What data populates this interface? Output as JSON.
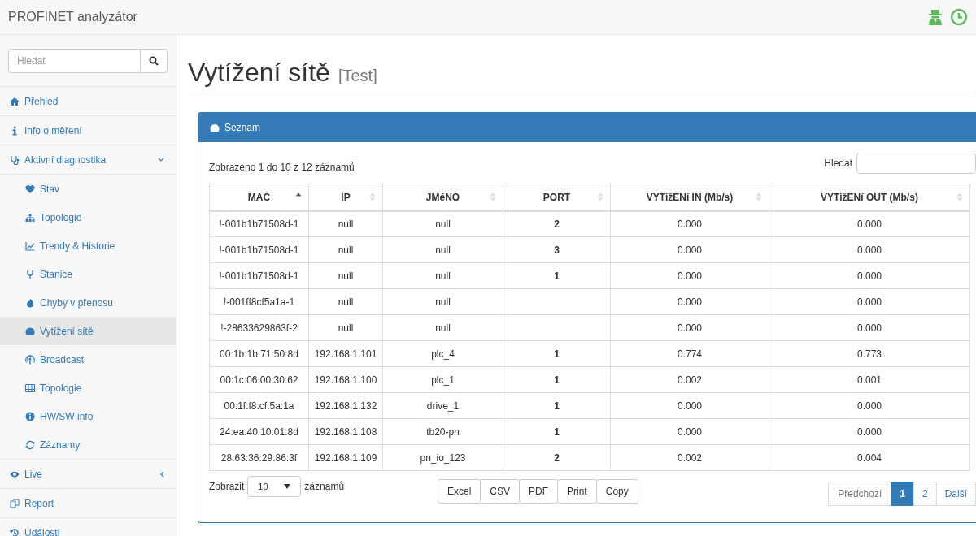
{
  "app": {
    "title": "PROFINET analyzátor"
  },
  "sidebar": {
    "search": {
      "placeholder": "Hledat"
    },
    "items": [
      {
        "label": "Přehled",
        "selected": false
      },
      {
        "label": "Info o měření",
        "selected": false
      },
      {
        "label": "Aktivní diagnostika",
        "selected": false,
        "expanded": true,
        "children": [
          {
            "label": "Stav",
            "selected": false
          },
          {
            "label": "Topologie",
            "selected": false
          },
          {
            "label": "Trendy & Historie",
            "selected": false
          },
          {
            "label": "Stanice",
            "selected": false
          },
          {
            "label": "Chyby v přenosu",
            "selected": false
          },
          {
            "label": "Vytížení sítě",
            "selected": true
          },
          {
            "label": "Broadcast",
            "selected": false
          },
          {
            "label": "Topologie",
            "selected": false
          },
          {
            "label": "HW/SW info",
            "selected": false
          },
          {
            "label": "Záznamy",
            "selected": false
          }
        ]
      },
      {
        "label": "Live",
        "selected": false,
        "expanded": false
      },
      {
        "label": "Report",
        "selected": false
      },
      {
        "label": "Události",
        "selected": false
      }
    ]
  },
  "page": {
    "title": "Vytížení sítě",
    "subtitle": "[Test]"
  },
  "panel": {
    "title": "Seznam",
    "info": "Zobrazeno 1 do 10 z 12 záznamů",
    "search_label": "Hledat",
    "columns": [
      {
        "label": "MAC",
        "sorted": true
      },
      {
        "label": "IP",
        "sorted": false
      },
      {
        "label": "JMéNO",
        "sorted": false
      },
      {
        "label": "PORT",
        "sorted": false
      },
      {
        "label": "VYTižENí IN (Mb/s)",
        "sorted": false
      },
      {
        "label": "VYTižENí OUT (Mb/s)",
        "sorted": false
      }
    ],
    "rows": [
      [
        "!-001b1b71508d-1",
        "null",
        "null",
        "2",
        "0.000",
        "0.000"
      ],
      [
        "!-001b1b71508d-1",
        "null",
        "null",
        "3",
        "0.000",
        "0.000"
      ],
      [
        "!-001b1b71508d-1",
        "null",
        "null",
        "1",
        "0.000",
        "0.000"
      ],
      [
        "!-001ff8cf5a1a-1",
        "null",
        "null",
        "",
        "0.000",
        "0.000"
      ],
      [
        "!-28633629863f-2",
        "null",
        "null",
        "",
        "0.000",
        "0.000"
      ],
      [
        "00:1b:1b:71:50:8d",
        "192.168.1.101",
        "plc_4",
        "1",
        "0.774",
        "0.773"
      ],
      [
        "00:1c:06:00:30:62",
        "192.168.1.100",
        "plc_1",
        "1",
        "0.002",
        "0.001"
      ],
      [
        "00:1f:f8:cf:5a:1a",
        "192.168.1.132",
        "drive_1",
        "1",
        "0.000",
        "0.000"
      ],
      [
        "24:ea:40:10:01:8d",
        "192.168.1.108",
        "tb20-pn",
        "1",
        "0.000",
        "0.000"
      ],
      [
        "28:63:36:29:86:3f",
        "192.168.1.109",
        "pn_io_123",
        "2",
        "0.002",
        "0.004"
      ]
    ],
    "length": {
      "label_before": "Zobrazit",
      "value": "10",
      "label_after": "záznamů"
    },
    "export_buttons": [
      "Excel",
      "CSV",
      "PDF",
      "Print",
      "Copy"
    ],
    "pagination": [
      {
        "label": "Předchozí",
        "kind": "prev",
        "selected": false,
        "disabled": true
      },
      {
        "label": "1",
        "kind": "page",
        "selected": true,
        "disabled": false
      },
      {
        "label": "2",
        "kind": "page",
        "selected": false,
        "disabled": false
      },
      {
        "label": "Další",
        "kind": "next",
        "selected": false,
        "disabled": false
      }
    ]
  }
}
